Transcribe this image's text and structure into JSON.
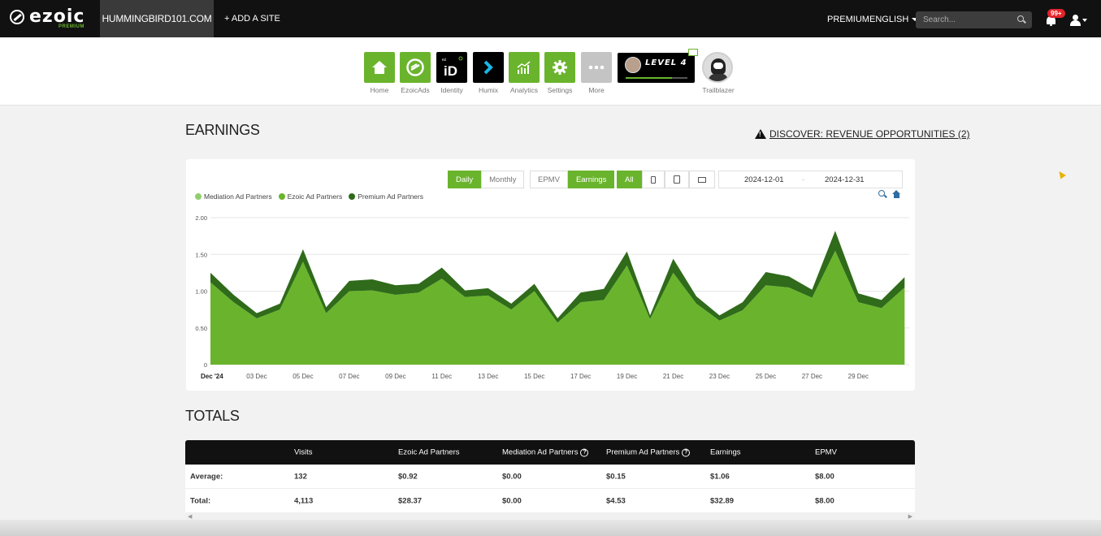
{
  "header": {
    "logo_text": "ezoic",
    "logo_sub": "PREMIUM",
    "site": "HUMMINGBIRD101.COM",
    "add_site": "+ ADD A SITE",
    "premium": "PREMIUM",
    "language": "ENGLISH",
    "search_placeholder": "Search...",
    "notification_badge": "99+"
  },
  "nav": {
    "items": [
      {
        "label": "Home",
        "icon": "home-icon"
      },
      {
        "label": "EzoicAds",
        "icon": "ezoicads-icon"
      },
      {
        "label": "Identity",
        "icon": "identity-icon"
      },
      {
        "label": "Humix",
        "icon": "humix-icon"
      },
      {
        "label": "Analytics",
        "icon": "analytics-icon"
      },
      {
        "label": "Settings",
        "icon": "gear-icon"
      },
      {
        "label": "More",
        "icon": "more-icon"
      }
    ],
    "level_text": "LEVEL 4",
    "level_progress": 0.75,
    "trailblazer": "Trailblazer"
  },
  "earnings": {
    "title": "EARNINGS",
    "discover": "DISCOVER: REVENUE OPPORTUNITIES (2)",
    "period_buttons": [
      "Daily",
      "Monthly"
    ],
    "metric_buttons": [
      "EPMV",
      "Earnings"
    ],
    "device_all": "All",
    "date_start": "2024-12-01",
    "date_sep": "-",
    "date_end": "2024-12-31"
  },
  "chart_data": {
    "type": "area",
    "stacked": true,
    "ylim": [
      0,
      2.0
    ],
    "yticks": [
      "2.00",
      "1.50",
      "1.00",
      "0.50",
      "0"
    ],
    "ytick_values": [
      2.0,
      1.5,
      1.0,
      0.5,
      0
    ],
    "xtick_labels": [
      "Dec '24",
      "03 Dec",
      "05 Dec",
      "07 Dec",
      "09 Dec",
      "11 Dec",
      "13 Dec",
      "15 Dec",
      "17 Dec",
      "19 Dec",
      "21 Dec",
      "23 Dec",
      "25 Dec",
      "27 Dec",
      "29 Dec"
    ],
    "xtick_days": [
      1,
      3,
      5,
      7,
      9,
      11,
      13,
      15,
      17,
      19,
      21,
      23,
      25,
      27,
      29
    ],
    "x_days": [
      1,
      2,
      3,
      4,
      5,
      6,
      7,
      8,
      9,
      10,
      11,
      12,
      13,
      14,
      15,
      16,
      17,
      18,
      19,
      20,
      21,
      22,
      23,
      24,
      25,
      26,
      27,
      28,
      29,
      30,
      31
    ],
    "series": [
      {
        "name": "Mediation Ad Partners",
        "color": "#8fcf6a",
        "values": [
          0,
          0,
          0,
          0,
          0,
          0,
          0,
          0,
          0,
          0,
          0,
          0,
          0,
          0,
          0,
          0,
          0,
          0,
          0,
          0,
          0,
          0,
          0,
          0,
          0,
          0,
          0,
          0,
          0,
          0,
          0
        ]
      },
      {
        "name": "Ezoic Ad Partners",
        "color": "#6ab42d",
        "values": [
          1.12,
          0.85,
          0.63,
          0.75,
          1.4,
          0.7,
          1.0,
          1.01,
          0.95,
          0.98,
          1.17,
          0.92,
          0.94,
          0.75,
          1.0,
          0.57,
          0.85,
          0.88,
          1.35,
          0.62,
          1.25,
          0.83,
          0.6,
          0.74,
          1.08,
          1.05,
          0.91,
          1.55,
          0.85,
          0.77,
          1.05
        ]
      },
      {
        "name": "Premium Ad Partners",
        "color": "#2f6b1a",
        "values": [
          0.13,
          0.1,
          0.07,
          0.08,
          0.17,
          0.08,
          0.14,
          0.15,
          0.13,
          0.12,
          0.15,
          0.09,
          0.1,
          0.08,
          0.1,
          0.06,
          0.13,
          0.15,
          0.19,
          0.05,
          0.19,
          0.1,
          0.07,
          0.11,
          0.18,
          0.15,
          0.11,
          0.27,
          0.12,
          0.11,
          0.14
        ]
      }
    ]
  },
  "totals": {
    "title": "TOTALS",
    "columns": [
      "",
      "Visits",
      "Ezoic Ad Partners",
      "Mediation Ad Partners",
      "Premium Ad Partners",
      "Earnings",
      "EPMV"
    ],
    "rows": [
      [
        "Average:",
        "132",
        "$0.92",
        "$0.00",
        "$0.15",
        "$1.06",
        "$8.00"
      ],
      [
        "Total:",
        "4,113",
        "$28.37",
        "$0.00",
        "$4.53",
        "$32.89",
        "$8.00"
      ]
    ]
  }
}
